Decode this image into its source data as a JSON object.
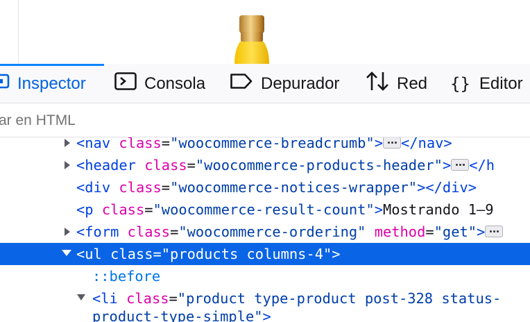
{
  "toolbar": {
    "tabs": [
      {
        "label": "Inspector",
        "icon": "inspector-icon",
        "selected": true
      },
      {
        "label": "Consola",
        "icon": "console-icon",
        "selected": false
      },
      {
        "label": "Depurador",
        "icon": "debugger-icon",
        "selected": false
      },
      {
        "label": "Red",
        "icon": "network-icon",
        "selected": false
      },
      {
        "label": "Editor",
        "icon": "style-editor-icon",
        "selected": false
      }
    ]
  },
  "search": {
    "placeholder": "ar en HTML"
  },
  "tree": {
    "nodes": [
      {
        "open": "<",
        "tag": "nav",
        "attr": "class",
        "eq": "=",
        "val": "\"woocommerce-breadcrumb\"",
        "close": ">",
        "end": "</nav>"
      },
      {
        "open": "<",
        "tag": "header",
        "attr": "class",
        "eq": "=",
        "val": "\"woocommerce-products-header\"",
        "close": ">",
        "end": "</h"
      },
      {
        "open": "<",
        "tag": "div",
        "attr": "class",
        "eq": "=",
        "val": "\"woocommerce-notices-wrapper\"",
        "close": ">",
        "end": "</div>"
      },
      {
        "open": "<",
        "tag": "p",
        "attr": "class",
        "eq": "=",
        "val": "\"woocommerce-result-count\"",
        "close": ">",
        "text": "Mostrando 1–9"
      },
      {
        "open": "<",
        "tag": "form",
        "attr": "class",
        "eq": "=",
        "val": "\"woocommerce-ordering\"",
        "attr2": "method",
        "eq2": "=",
        "val2": "\"get\"",
        "close": ">"
      },
      {
        "line": "<ul class=\"products columns-4\">"
      },
      {
        "pseudo": "::before"
      },
      {
        "open": "<",
        "tag": "li",
        "attr": "class",
        "eq": "=",
        "val": "\"product type-product post-328 status-"
      },
      {
        "val": "product-type-simple\"",
        "close": ">"
      }
    ]
  },
  "colors": {
    "accent": "#0a84ff",
    "selected_row": "#0a64e6",
    "tag": "#0040e0",
    "attr": "#dd00a9",
    "value": "#003eaa"
  }
}
